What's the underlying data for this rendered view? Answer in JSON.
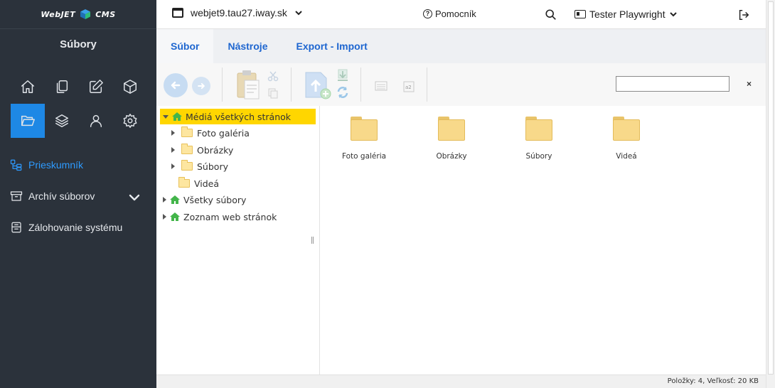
{
  "brand": {
    "logo_left": "WebJET",
    "logo_right": "CMS"
  },
  "sidebar": {
    "section_title": "Súbory",
    "icons": [
      "home-icon",
      "pages-icon",
      "edit-icon",
      "box-icon",
      "folder-open-icon",
      "layers-icon",
      "user-icon",
      "gear-icon"
    ],
    "active_icon": "folder-open-icon",
    "nav": [
      {
        "label": "Prieskumník",
        "icon": "explorer-icon",
        "active": true
      },
      {
        "label": "Archív súborov",
        "icon": "archive-icon",
        "expandable": true
      },
      {
        "label": "Zálohovanie systému",
        "icon": "backup-icon"
      }
    ]
  },
  "header": {
    "domain": "webjet9.tau27.iway.sk",
    "help_label": "Pomocník",
    "user_name": "Tester Playwright"
  },
  "tabs": [
    {
      "label": "Súbor",
      "active": true
    },
    {
      "label": "Nástroje"
    },
    {
      "label": "Export - Import"
    }
  ],
  "toolbar": {
    "search_value": "",
    "close_symbol": "×"
  },
  "tree": {
    "root": "Médiá všetkých stránok",
    "children": [
      "Foto galéria",
      "Obrázky",
      "Súbory",
      "Videá"
    ],
    "others": [
      "Všetky súbory",
      "Zoznam web stránok"
    ]
  },
  "folders": [
    "Foto galéria",
    "Obrázky",
    "Súbory",
    "Videá"
  ],
  "status": {
    "text": "Položky: 4, Veľkosť: 20 KB"
  },
  "colors": {
    "sidebar_bg": "#2b323b",
    "accent": "#1e88e5",
    "tab_text": "#1e66d0",
    "tree_selected": "#ffd600"
  }
}
